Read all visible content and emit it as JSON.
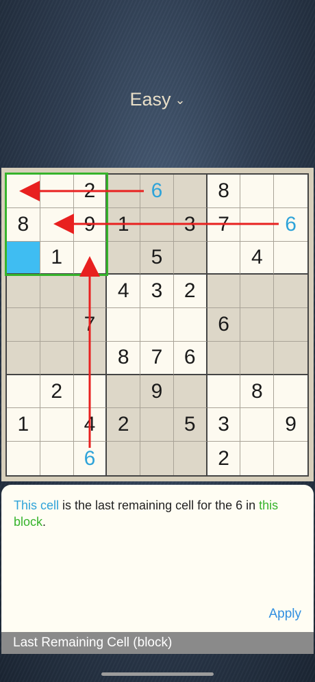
{
  "header": {
    "difficulty": "Easy"
  },
  "board": {
    "rows": [
      [
        "",
        "",
        "2",
        "",
        "6",
        "",
        "8",
        "",
        ""
      ],
      [
        "8",
        "",
        "9",
        "1",
        "",
        "3",
        "7",
        "",
        "6"
      ],
      [
        "",
        "1",
        "",
        "",
        "5",
        "",
        "",
        "4",
        ""
      ],
      [
        "",
        "",
        "",
        "4",
        "3",
        "2",
        "",
        "",
        ""
      ],
      [
        "",
        "",
        "7",
        "",
        "",
        "",
        "6",
        "",
        ""
      ],
      [
        "",
        "",
        "",
        "8",
        "7",
        "6",
        "",
        "",
        ""
      ],
      [
        "",
        "2",
        "",
        "",
        "9",
        "",
        "",
        "8",
        ""
      ],
      [
        "1",
        "",
        "4",
        "2",
        "",
        "5",
        "3",
        "",
        "9"
      ],
      [
        "",
        "",
        "6",
        "",
        "",
        "",
        "2",
        "",
        ""
      ]
    ],
    "hint_digits": [
      [
        0,
        4
      ],
      [
        1,
        8
      ],
      [
        8,
        2
      ]
    ],
    "selected_cell": [
      2,
      0
    ]
  },
  "hint": {
    "part1": "This cell",
    "part2": " is the last remaining cell for the 6 in ",
    "part3": "this block",
    "part4": "."
  },
  "actions": {
    "apply_label": "Apply"
  },
  "technique": {
    "name": "Last Remaining Cell (block)"
  },
  "colors": {
    "highlight_blue": "#3fbdf2",
    "block_green": "#36b32b",
    "arrow_red": "#e8201f",
    "link_blue": "#2f8ee0"
  }
}
